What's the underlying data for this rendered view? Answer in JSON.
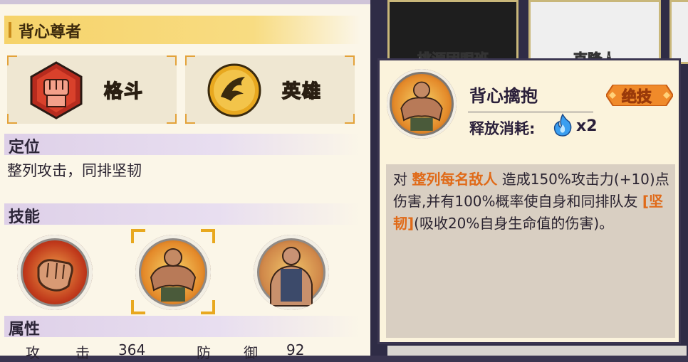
{
  "hero": {
    "title": "背心尊者",
    "class_label": "格斗",
    "rank_label": "英雄"
  },
  "sections": {
    "position_title": "定位",
    "position_desc": "整列攻击，同排坚韧",
    "skills_title": "技能",
    "attrs_title": "属性"
  },
  "attributes": {
    "atk_label_1": "攻",
    "atk_label_2": "击",
    "atk_value": "364",
    "def_label_1": "防",
    "def_label_2": "御",
    "def_value": "92"
  },
  "background_cards": [
    {
      "name": "桃源团眼班"
    },
    {
      "name": "克隆人"
    }
  ],
  "popup": {
    "skill_name": "背心擒抱",
    "badge": "绝技",
    "cost_label": "释放消耗:",
    "cost_mult": "x2",
    "desc": {
      "p1": "对 ",
      "h1": "整列每名敌人",
      "p2": " 造成150%攻击力(+10)点伤害,并有100%概率使自身和同排队友 ",
      "h2": "[坚韧]",
      "p3": "(吸收20%自身生命值的伤害)。"
    }
  },
  "colors": {
    "title_bar": "#f6d36a",
    "section_bar": "#ded0e8",
    "highlight": "#e06a18",
    "badge": "#f08a2a",
    "selection_bracket": "#e8a81f"
  },
  "icons": {
    "class_icon": "fist-icon",
    "rank_icon": "eagle-icon",
    "cost_icon": "blue-flame-icon"
  }
}
